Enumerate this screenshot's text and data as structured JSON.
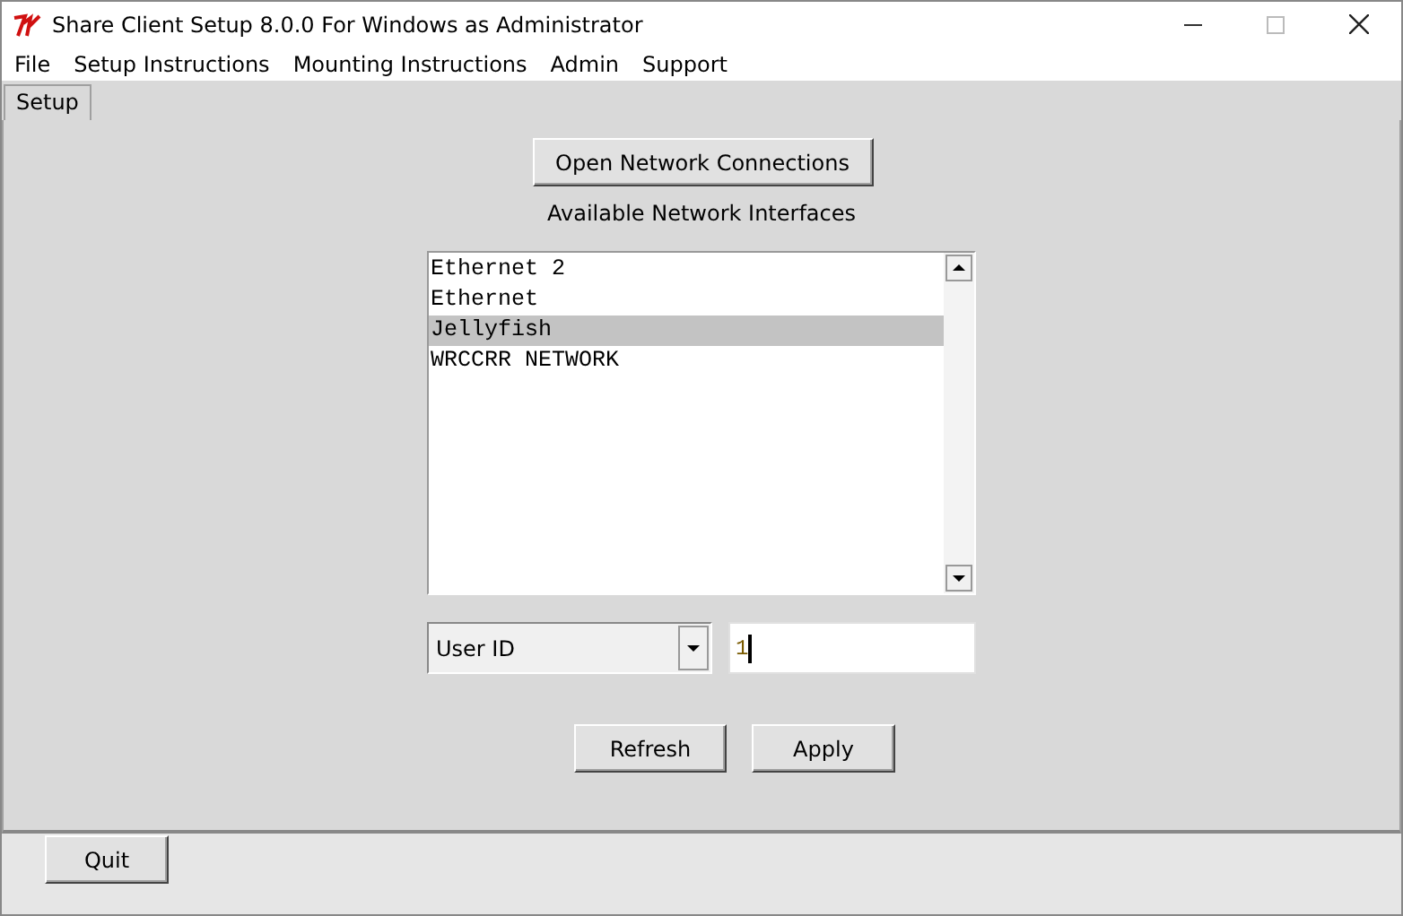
{
  "window": {
    "title": "Share Client Setup 8.0.0 For Windows as Administrator"
  },
  "menu": [
    "File",
    "Setup Instructions",
    "Mounting Instructions",
    "Admin",
    "Support"
  ],
  "tabs": [
    {
      "label": "Setup",
      "selected": true
    }
  ],
  "open_button": "Open Network Connections",
  "interfaces_label": "Available Network Interfaces",
  "interfaces": [
    {
      "name": "Ethernet 2",
      "selected": false
    },
    {
      "name": "Ethernet",
      "selected": false
    },
    {
      "name": "Jellyfish",
      "selected": true
    },
    {
      "name": "WRCCRR NETWORK",
      "selected": false
    }
  ],
  "id_type": {
    "value": "User ID"
  },
  "id_field": {
    "value": "1"
  },
  "buttons": [
    "Refresh",
    "Apply"
  ],
  "quit_button": "Quit"
}
